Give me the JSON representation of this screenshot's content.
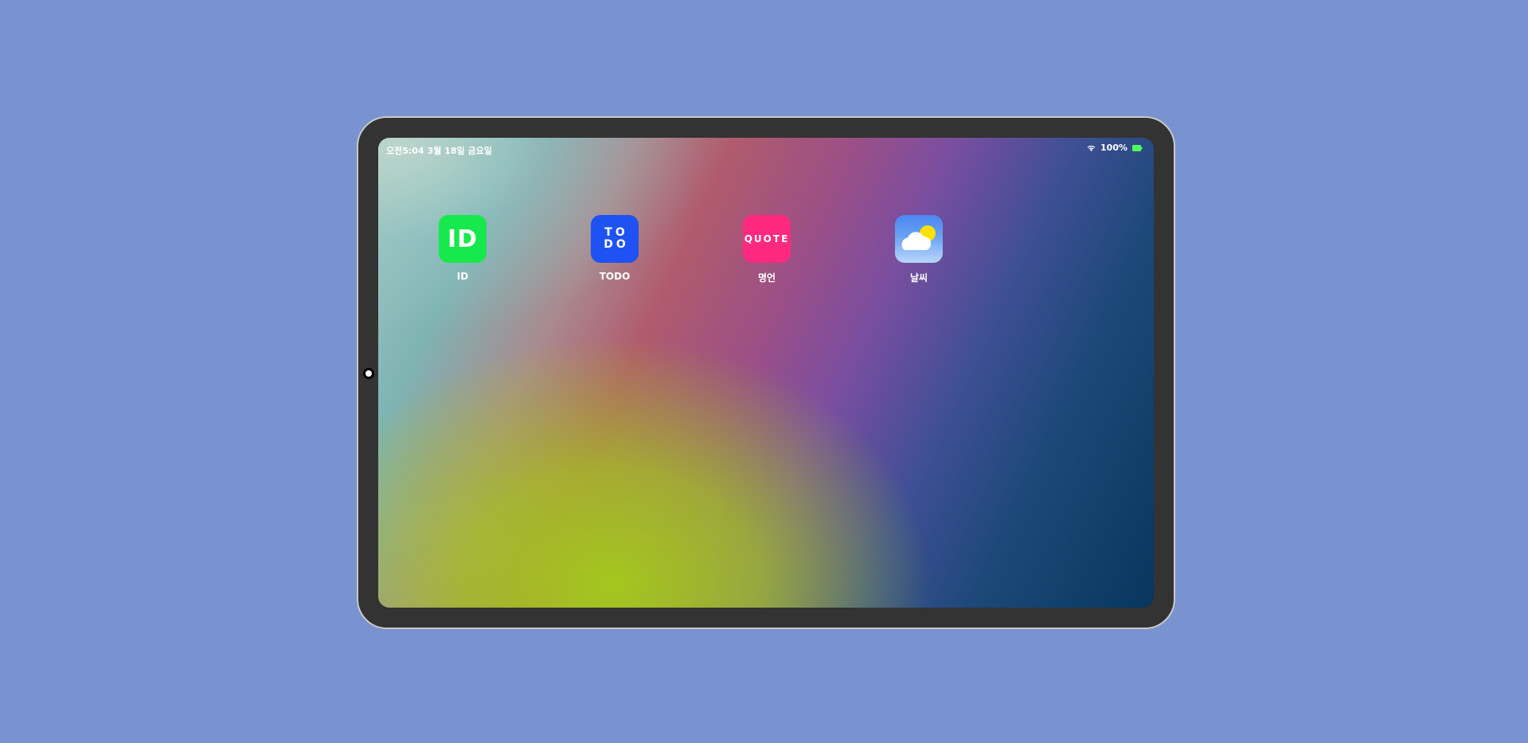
{
  "status_bar": {
    "ampm": "오전",
    "time": "5:04",
    "date": "3월 18일 금요일",
    "battery_percent": "100%",
    "wifi_icon": "wifi-icon",
    "battery_icon": "battery-icon",
    "battery_color": "#4cff5a"
  },
  "apps": [
    {
      "label": "ID",
      "icon_text": "ID",
      "icon": "id-app-icon",
      "color": "#17e84c"
    },
    {
      "label": "TODO",
      "icon_text_line1": "TO",
      "icon_text_line2": "DO",
      "icon": "todo-app-icon",
      "color": "#1e52f2"
    },
    {
      "label": "명언",
      "icon_text": "QUOTE",
      "icon": "quote-app-icon",
      "color": "#ff2a80"
    },
    {
      "label": "날씨",
      "icon": "weather-app-icon",
      "color": "#4a86f0"
    }
  ],
  "colors": {
    "background": "#7993d0",
    "bezel": "#333333"
  }
}
